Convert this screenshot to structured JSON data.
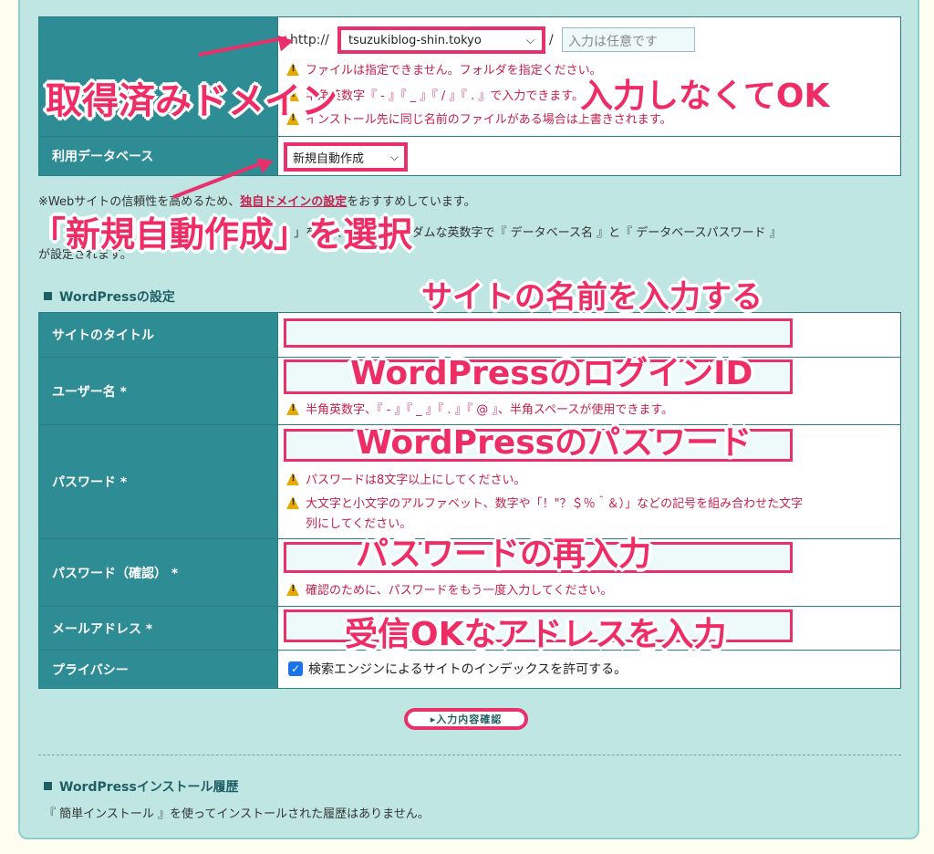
{
  "domain_row": {
    "scheme": "http://",
    "domain_value": "tsuzukiblog-shin.tokyo",
    "separator": "/",
    "path_placeholder": "入力は任意です",
    "warnings": [
      "ファイルは指定できません。フォルダを指定ください。",
      "半角英数字『 - 』『 _ 』『 / 』『 . 』で入力できます。",
      "インストール先に同じ名前のファイルがある場合は上書きされます。"
    ]
  },
  "database_row": {
    "label": "利用データベース",
    "value": "新規自動作成"
  },
  "notes": {
    "line1_prefix": "※Webサイトの信頼性を高めるため、",
    "line1_link": "独自ドメインの設定",
    "line1_suffix": "をおすすめしています。",
    "line2_visible": "」を選択すると、ランダムな英数字で『 データベース名 』と『 データベースパスワード 』",
    "line3": "が設定されます。"
  },
  "wp_section": {
    "title": "WordPressの設定",
    "site_title_label": "サイトのタイトル",
    "username_label": "ユーザー名 *",
    "username_warning": "半角英数字、『 - 』『 _ 』『 . 』『 @ 』、半角スペースが使用できます。",
    "password_label": "パスワード *",
    "password_warning_1": "パスワードは8文字以上にしてください。",
    "password_warning_2a": "大文字と小文字のアルファベット、数字や「！\"？＄％＾＆）」などの記号を組み合わせた文字",
    "password_warning_2b": "列にしてください。",
    "password_confirm_label": "パスワード（確認） *",
    "password_confirm_warning": "確認のために、パスワードをもう一度入力してください。",
    "email_label": "メールアドレス *",
    "privacy_label": "プライバシー",
    "privacy_checkbox_text": "検索エンジンによるサイトのインデックスを許可する。",
    "privacy_checked": true
  },
  "confirm_button": "▸入力内容確認",
  "history": {
    "title": "WordPressインストール履歴",
    "text": "『 簡単インストール 』を使ってインストールされた履歴はありません。"
  },
  "annotations": {
    "domain": "取得済みドメイン",
    "path": "入力しなくてOK",
    "database": "「新規自動作成」を選択",
    "site_title": "サイトの名前を入力する",
    "username": "WordPressのログインID",
    "password": "WordPressのパスワード",
    "password_confirm": "パスワードの再入力",
    "email": "受信OKなアドレスを入力"
  },
  "colors": {
    "accent": "#e8306b",
    "header_cell": "#2e8c94",
    "warning_text": "#c5204d",
    "panel": "#bfe6e3"
  }
}
